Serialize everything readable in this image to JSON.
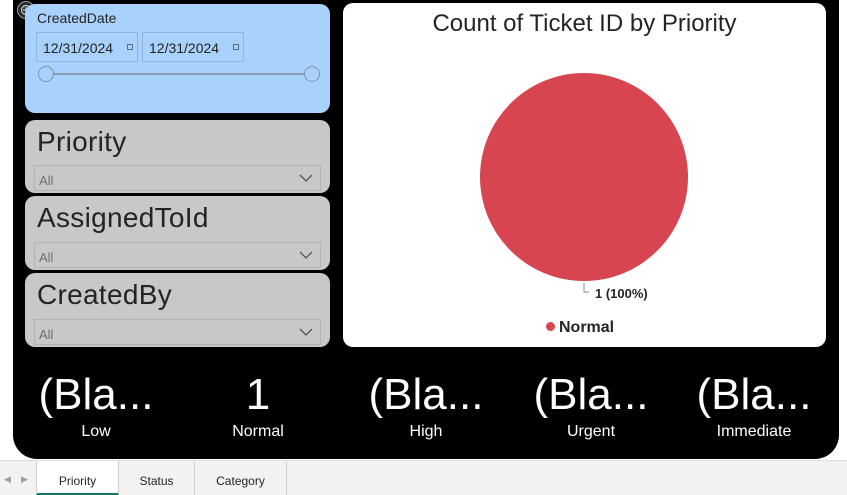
{
  "date_slicer": {
    "title": "CreatedDate",
    "start": "12/31/2024",
    "end": "12/31/2024"
  },
  "slicers": {
    "priority": {
      "title": "Priority",
      "value": "All"
    },
    "assigned_to": {
      "title": "AssignedToId",
      "value": "All"
    },
    "created_by": {
      "title": "CreatedBy",
      "value": "All"
    }
  },
  "chart_data": {
    "type": "pie",
    "title": "Count of Ticket ID by Priority",
    "slices": [
      {
        "label": "Normal",
        "value": 1,
        "data_label": "1 (100%)",
        "color": "#d64550"
      }
    ],
    "legend": [
      "Normal"
    ],
    "legend_position": "bottom"
  },
  "cards": [
    {
      "value": "(Bla...",
      "label": "Low"
    },
    {
      "value": "1",
      "label": "Normal"
    },
    {
      "value": "(Bla...",
      "label": "High"
    },
    {
      "value": "(Bla...",
      "label": "Urgent"
    },
    {
      "value": "(Bla...",
      "label": "Immediate"
    }
  ],
  "tabs": [
    {
      "label": "Priority",
      "active": true
    },
    {
      "label": "Status",
      "active": false
    },
    {
      "label": "Category",
      "active": false
    }
  ],
  "colors": {
    "report_background": "#000000",
    "date_slicer_background": "#a8d1fb",
    "slicer_background": "#c8c8c8",
    "pie_normal": "#d64550",
    "active_tab_underline": "#117865"
  }
}
